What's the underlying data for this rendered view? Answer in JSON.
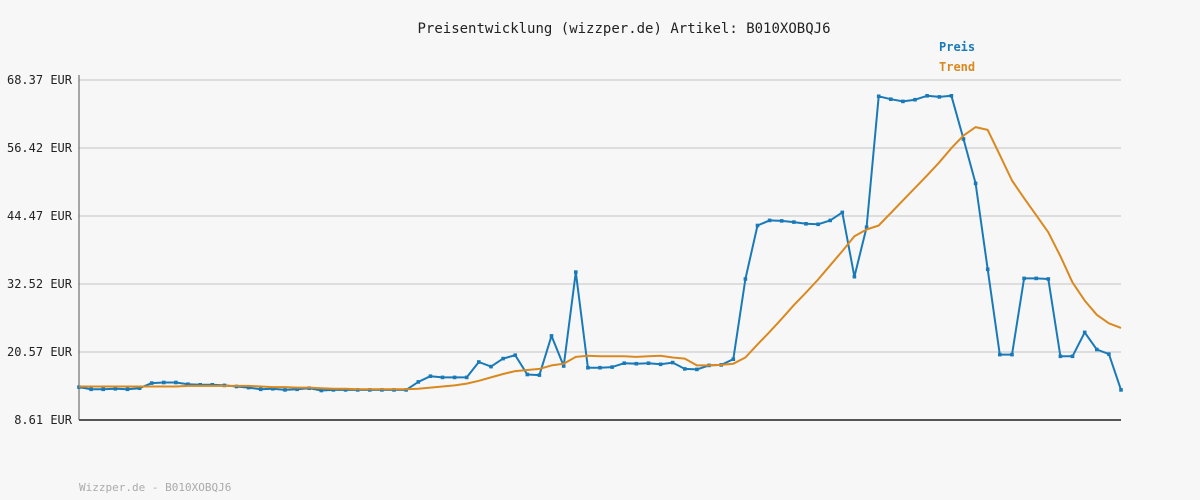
{
  "chart_data": {
    "type": "line",
    "title": "Preisentwicklung (wizzper.de) Artikel: B010XOBQJ6",
    "footer": "Wizzper.de - B010XOBQJ6",
    "xlabel": "",
    "ylabel": "",
    "ylim": [
      8.61,
      68.37
    ],
    "yticks": [
      {
        "value": 8.61,
        "label": "8.61 EUR"
      },
      {
        "value": 20.57,
        "label": "20.57 EUR"
      },
      {
        "value": 32.52,
        "label": "32.52 EUR"
      },
      {
        "value": 44.47,
        "label": "44.47 EUR"
      },
      {
        "value": 56.42,
        "label": "56.42 EUR"
      },
      {
        "value": 68.37,
        "label": "68.37 EUR"
      }
    ],
    "grid": true,
    "legend_position": "top-right",
    "colors": {
      "preis": "#1a7ab8",
      "trend": "#d9891f",
      "grid": "#dddddd",
      "axis": "#555555"
    },
    "series": [
      {
        "name": "Preis",
        "color": "#1a7ab8",
        "markers": true,
        "values": [
          14.4,
          14.0,
          14.0,
          14.1,
          14.0,
          14.2,
          15.1,
          15.2,
          15.2,
          14.9,
          14.8,
          14.8,
          14.7,
          14.5,
          14.3,
          14.0,
          14.1,
          13.9,
          14.0,
          14.2,
          13.8,
          13.9,
          13.9,
          13.9,
          13.9,
          13.9,
          13.9,
          13.9,
          15.3,
          16.3,
          16.1,
          16.1,
          16.1,
          18.8,
          18.0,
          19.4,
          20.0,
          16.6,
          16.5,
          23.4,
          18.1,
          34.6,
          17.8,
          17.8,
          17.9,
          18.6,
          18.5,
          18.6,
          18.4,
          18.7,
          17.6,
          17.5,
          18.2,
          18.3,
          19.3,
          33.4,
          42.8,
          43.7,
          43.6,
          43.4,
          43.1,
          43.0,
          43.7,
          45.1,
          33.8,
          42.5,
          65.5,
          65.0,
          64.6,
          64.9,
          65.6,
          65.4,
          65.6,
          58.0,
          50.2,
          35.1,
          20.1,
          20.1,
          33.5,
          33.5,
          33.4,
          19.8,
          19.8,
          24.0,
          21.0,
          20.2,
          13.9
        ]
      },
      {
        "name": "Trend",
        "color": "#d9891f",
        "markers": false,
        "values": [
          14.5,
          14.5,
          14.5,
          14.5,
          14.5,
          14.5,
          14.5,
          14.5,
          14.5,
          14.6,
          14.6,
          14.6,
          14.6,
          14.6,
          14.6,
          14.5,
          14.4,
          14.4,
          14.3,
          14.3,
          14.2,
          14.1,
          14.1,
          14.0,
          14.0,
          14.0,
          14.0,
          14.0,
          14.1,
          14.3,
          14.5,
          14.7,
          15.0,
          15.5,
          16.1,
          16.7,
          17.2,
          17.4,
          17.6,
          18.2,
          18.5,
          19.7,
          19.9,
          19.8,
          19.8,
          19.8,
          19.7,
          19.8,
          19.9,
          19.6,
          19.4,
          18.2,
          18.2,
          18.3,
          18.5,
          19.6,
          21.9,
          24.1,
          26.4,
          28.8,
          31.0,
          33.3,
          35.8,
          38.3,
          40.9,
          42.1,
          42.8,
          45.0,
          47.2,
          49.4,
          51.6,
          53.9,
          56.4,
          58.6,
          60.1,
          59.6,
          55.2,
          50.7,
          47.6,
          44.6,
          41.6,
          37.4,
          32.8,
          29.6,
          27.1,
          25.6,
          24.8
        ]
      }
    ]
  }
}
